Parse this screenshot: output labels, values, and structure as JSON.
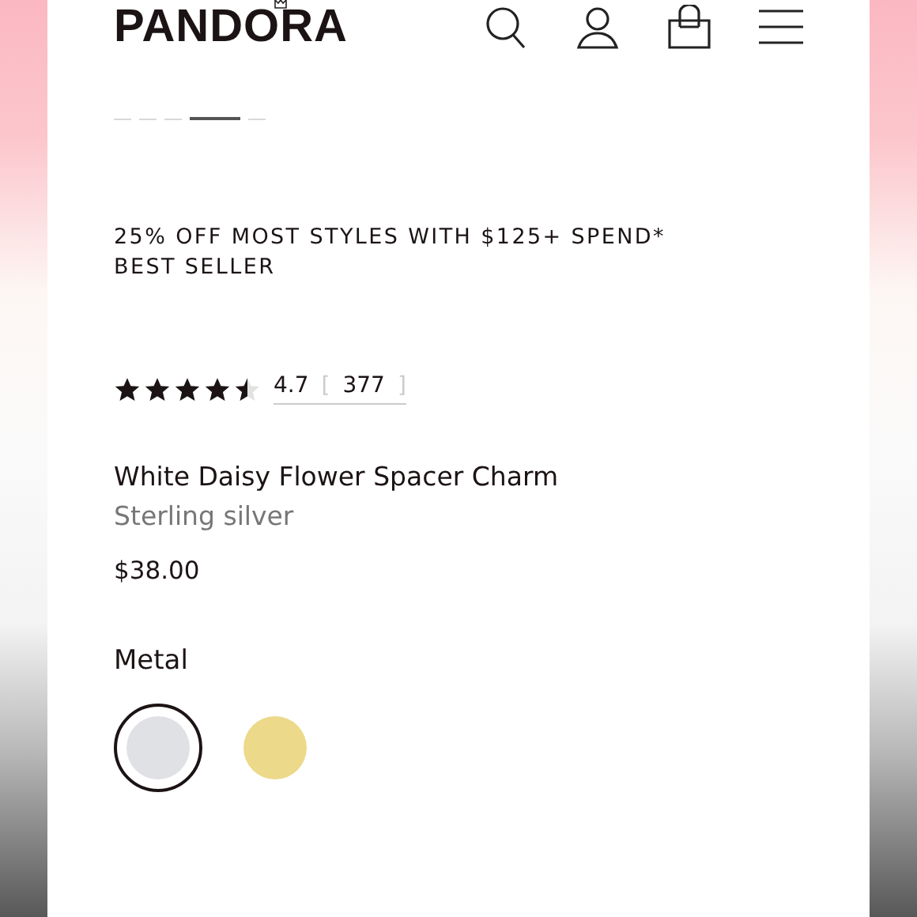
{
  "header": {
    "logo": "PANDORA"
  },
  "carousel": {
    "dots": [
      {
        "selected": false
      },
      {
        "selected": false
      },
      {
        "selected": false
      },
      {
        "selected": true
      },
      {
        "selected": false
      }
    ]
  },
  "promo": [
    "25% OFF MOST STYLES WITH $125+ SPEND*",
    "BEST SELLER"
  ],
  "rating": {
    "stars": 4.5,
    "score": "4.7",
    "open_bracket": "[",
    "reviews": "377",
    "close_bracket": "]"
  },
  "product": {
    "name": "White Daisy Flower Spacer Charm",
    "material": "Sterling silver",
    "price": "$38.00"
  },
  "metal": {
    "label": "Metal",
    "options": [
      {
        "color": "#dfe1e4",
        "selected": true
      },
      {
        "color": "#ecd98a",
        "selected": false
      }
    ]
  }
}
